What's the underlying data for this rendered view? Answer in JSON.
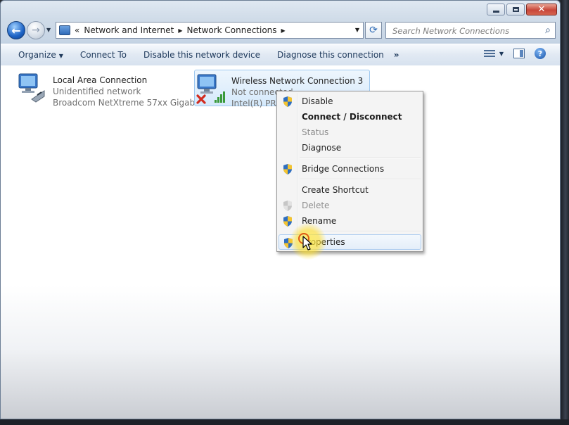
{
  "window": {
    "caption_buttons": {
      "minimize": "minimize",
      "maximize": "maximize",
      "close": "✕"
    }
  },
  "nav": {
    "breadcrumb": [
      {
        "label": "Network and Internet"
      },
      {
        "label": "Network Connections"
      }
    ],
    "search_placeholder": "Search Network Connections"
  },
  "toolbar": {
    "organize": "Organize",
    "connect_to": "Connect To",
    "disable_device": "Disable this network device",
    "diagnose": "Diagnose this connection",
    "more": "»"
  },
  "adapters": [
    {
      "name": "Local Area Connection",
      "status": "Unidentified network",
      "device": "Broadcom NetXtreme 57xx Gigabi..."
    },
    {
      "name": "Wireless Network Connection 3",
      "status": "Not connected",
      "device": "Intel(R) PRO..."
    }
  ],
  "context_menu": {
    "items": [
      {
        "label": "Disable",
        "shield": true,
        "state": "normal"
      },
      {
        "label": "Connect / Disconnect",
        "shield": false,
        "state": "bold"
      },
      {
        "label": "Status",
        "shield": false,
        "state": "disabled"
      },
      {
        "label": "Diagnose",
        "shield": false,
        "state": "normal"
      },
      {
        "label": "Bridge Connections",
        "shield": true,
        "state": "normal"
      },
      {
        "label": "Create Shortcut",
        "shield": false,
        "state": "normal"
      },
      {
        "label": "Delete",
        "shield": true,
        "state": "disabled"
      },
      {
        "label": "Rename",
        "shield": true,
        "state": "normal"
      },
      {
        "label": "Properties",
        "shield": true,
        "state": "highlighted"
      }
    ]
  },
  "icons": {
    "back": "back-arrow-icon",
    "forward": "forward-arrow-icon",
    "refresh": "refresh-icon",
    "search": "search-icon",
    "shield": "uac-shield-icon",
    "network_adapter": "network-adapter-icon",
    "disconnected": "red-x-icon",
    "signal": "signal-bars-icon"
  },
  "colors": {
    "window_chrome": "#c7d5e5",
    "accent_blue": "#1d63c5",
    "close_red": "#c8473a",
    "selection": "#d5e9fb",
    "cursor_highlight": "#ffde28"
  }
}
